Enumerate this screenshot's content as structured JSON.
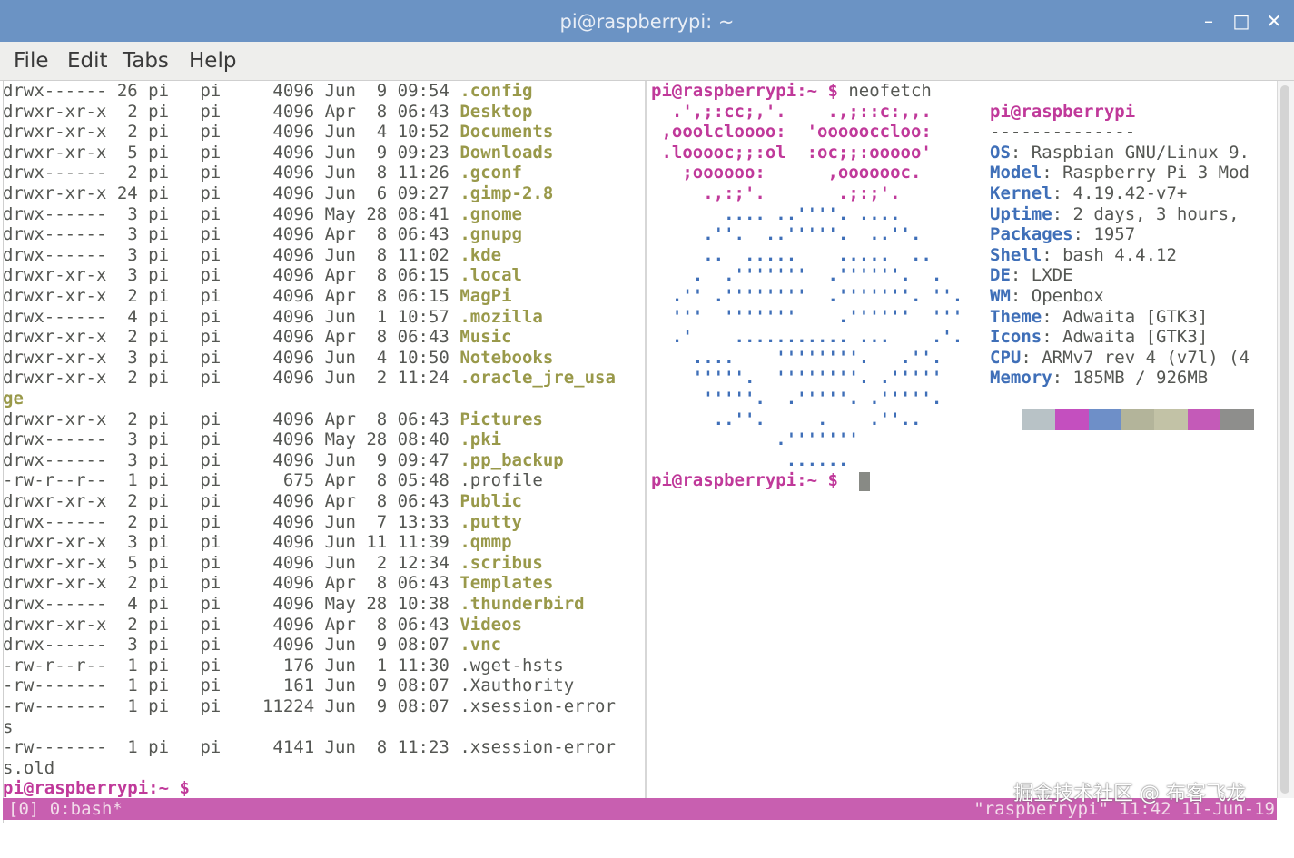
{
  "window": {
    "title": "pi@raspberrypi: ~",
    "minimize_label": "–",
    "maximize_label": "□",
    "close_label": "✕"
  },
  "menu": [
    "File",
    "Edit",
    "Tabs",
    "Help"
  ],
  "left_pane": {
    "listing": [
      {
        "perm": "drwx------",
        "links": "26",
        "owner": "pi",
        "group": "pi",
        "size": "4096",
        "month": "Jun",
        "day": "9",
        "time": "09:54",
        "name": ".config",
        "type": "dir"
      },
      {
        "perm": "drwxr-xr-x",
        "links": "2",
        "owner": "pi",
        "group": "pi",
        "size": "4096",
        "month": "Apr",
        "day": "8",
        "time": "06:43",
        "name": "Desktop",
        "type": "dir"
      },
      {
        "perm": "drwxr-xr-x",
        "links": "2",
        "owner": "pi",
        "group": "pi",
        "size": "4096",
        "month": "Jun",
        "day": "4",
        "time": "10:52",
        "name": "Documents",
        "type": "dir"
      },
      {
        "perm": "drwxr-xr-x",
        "links": "5",
        "owner": "pi",
        "group": "pi",
        "size": "4096",
        "month": "Jun",
        "day": "9",
        "time": "09:23",
        "name": "Downloads",
        "type": "dir"
      },
      {
        "perm": "drwx------",
        "links": "2",
        "owner": "pi",
        "group": "pi",
        "size": "4096",
        "month": "Jun",
        "day": "8",
        "time": "11:26",
        "name": ".gconf",
        "type": "dir"
      },
      {
        "perm": "drwxr-xr-x",
        "links": "24",
        "owner": "pi",
        "group": "pi",
        "size": "4096",
        "month": "Jun",
        "day": "6",
        "time": "09:27",
        "name": ".gimp-2.8",
        "type": "dir"
      },
      {
        "perm": "drwx------",
        "links": "3",
        "owner": "pi",
        "group": "pi",
        "size": "4096",
        "month": "May",
        "day": "28",
        "time": "08:41",
        "name": ".gnome",
        "type": "dir"
      },
      {
        "perm": "drwx------",
        "links": "3",
        "owner": "pi",
        "group": "pi",
        "size": "4096",
        "month": "Apr",
        "day": "8",
        "time": "06:43",
        "name": ".gnupg",
        "type": "dir"
      },
      {
        "perm": "drwx------",
        "links": "3",
        "owner": "pi",
        "group": "pi",
        "size": "4096",
        "month": "Jun",
        "day": "8",
        "time": "11:02",
        "name": ".kde",
        "type": "dir"
      },
      {
        "perm": "drwxr-xr-x",
        "links": "3",
        "owner": "pi",
        "group": "pi",
        "size": "4096",
        "month": "Apr",
        "day": "8",
        "time": "06:15",
        "name": ".local",
        "type": "dir"
      },
      {
        "perm": "drwxr-xr-x",
        "links": "2",
        "owner": "pi",
        "group": "pi",
        "size": "4096",
        "month": "Apr",
        "day": "8",
        "time": "06:15",
        "name": "MagPi",
        "type": "dir"
      },
      {
        "perm": "drwx------",
        "links": "4",
        "owner": "pi",
        "group": "pi",
        "size": "4096",
        "month": "Jun",
        "day": "1",
        "time": "10:57",
        "name": ".mozilla",
        "type": "dir"
      },
      {
        "perm": "drwxr-xr-x",
        "links": "2",
        "owner": "pi",
        "group": "pi",
        "size": "4096",
        "month": "Apr",
        "day": "8",
        "time": "06:43",
        "name": "Music",
        "type": "dir"
      },
      {
        "perm": "drwxr-xr-x",
        "links": "3",
        "owner": "pi",
        "group": "pi",
        "size": "4096",
        "month": "Jun",
        "day": "4",
        "time": "10:50",
        "name": "Notebooks",
        "type": "dir"
      },
      {
        "perm": "drwxr-xr-x",
        "links": "2",
        "owner": "pi",
        "group": "pi",
        "size": "4096",
        "month": "Jun",
        "day": "2",
        "time": "11:24",
        "name": ".oracle_jre_usa",
        "wrap": "ge",
        "type": "dir"
      },
      {
        "perm": "drwxr-xr-x",
        "links": "2",
        "owner": "pi",
        "group": "pi",
        "size": "4096",
        "month": "Apr",
        "day": "8",
        "time": "06:43",
        "name": "Pictures",
        "type": "dir"
      },
      {
        "perm": "drwx------",
        "links": "3",
        "owner": "pi",
        "group": "pi",
        "size": "4096",
        "month": "May",
        "day": "28",
        "time": "08:40",
        "name": ".pki",
        "type": "dir"
      },
      {
        "perm": "drwx------",
        "links": "3",
        "owner": "pi",
        "group": "pi",
        "size": "4096",
        "month": "Jun",
        "day": "9",
        "time": "09:47",
        "name": ".pp_backup",
        "type": "dir"
      },
      {
        "perm": "-rw-r--r--",
        "links": "1",
        "owner": "pi",
        "group": "pi",
        "size": "675",
        "month": "Apr",
        "day": "8",
        "time": "05:48",
        "name": ".profile",
        "type": "file"
      },
      {
        "perm": "drwxr-xr-x",
        "links": "2",
        "owner": "pi",
        "group": "pi",
        "size": "4096",
        "month": "Apr",
        "day": "8",
        "time": "06:43",
        "name": "Public",
        "type": "dir"
      },
      {
        "perm": "drwx------",
        "links": "2",
        "owner": "pi",
        "group": "pi",
        "size": "4096",
        "month": "Jun",
        "day": "7",
        "time": "13:33",
        "name": ".putty",
        "type": "dir"
      },
      {
        "perm": "drwxr-xr-x",
        "links": "3",
        "owner": "pi",
        "group": "pi",
        "size": "4096",
        "month": "Jun",
        "day": "11",
        "time": "11:39",
        "name": ".qmmp",
        "type": "dir"
      },
      {
        "perm": "drwxr-xr-x",
        "links": "5",
        "owner": "pi",
        "group": "pi",
        "size": "4096",
        "month": "Jun",
        "day": "2",
        "time": "12:34",
        "name": ".scribus",
        "type": "dir"
      },
      {
        "perm": "drwxr-xr-x",
        "links": "2",
        "owner": "pi",
        "group": "pi",
        "size": "4096",
        "month": "Apr",
        "day": "8",
        "time": "06:43",
        "name": "Templates",
        "type": "dir"
      },
      {
        "perm": "drwx------",
        "links": "4",
        "owner": "pi",
        "group": "pi",
        "size": "4096",
        "month": "May",
        "day": "28",
        "time": "10:38",
        "name": ".thunderbird",
        "type": "dir"
      },
      {
        "perm": "drwxr-xr-x",
        "links": "2",
        "owner": "pi",
        "group": "pi",
        "size": "4096",
        "month": "Apr",
        "day": "8",
        "time": "06:43",
        "name": "Videos",
        "type": "dir"
      },
      {
        "perm": "drwx------",
        "links": "3",
        "owner": "pi",
        "group": "pi",
        "size": "4096",
        "month": "Jun",
        "day": "9",
        "time": "08:07",
        "name": ".vnc",
        "type": "dir"
      },
      {
        "perm": "-rw-r--r--",
        "links": "1",
        "owner": "pi",
        "group": "pi",
        "size": "176",
        "month": "Jun",
        "day": "1",
        "time": "11:30",
        "name": ".wget-hsts",
        "type": "file"
      },
      {
        "perm": "-rw-------",
        "links": "1",
        "owner": "pi",
        "group": "pi",
        "size": "161",
        "month": "Jun",
        "day": "9",
        "time": "08:07",
        "name": ".Xauthority",
        "type": "file"
      },
      {
        "perm": "-rw-------",
        "links": "1",
        "owner": "pi",
        "group": "pi",
        "size": "11224",
        "month": "Jun",
        "day": "9",
        "time": "08:07",
        "name": ".xsession-error",
        "wrap": "s",
        "type": "file"
      },
      {
        "perm": "-rw-------",
        "links": "1",
        "owner": "pi",
        "group": "pi",
        "size": "4141",
        "month": "Jun",
        "day": "8",
        "time": "11:23",
        "name": ".xsession-error",
        "wrap": "s.old",
        "type": "file"
      }
    ],
    "prompt": "pi@raspberrypi:~ $"
  },
  "right_pane": {
    "prompt": "pi@raspberrypi:~ $",
    "command": " neofetch",
    "ascii_art": [
      {
        "text": "  .',;:cc;,'.    .,;::c:,,.",
        "style": "m"
      },
      {
        "text": " ,ooolcloooo:  'oooooccloo:",
        "style": "m"
      },
      {
        "text": " .looooc;;:ol  :oc;;:ooooo'",
        "style": "m"
      },
      {
        "text": "   ;oooooo:      ,ooooooc.",
        "style": "m"
      },
      {
        "text": "     .,:;'.       .;:;'.",
        "style": "m"
      },
      {
        "text": "       .... ..''''. ....",
        "style": "b"
      },
      {
        "text": "     .''.  ..'''''.  ..''.",
        "style": "b"
      },
      {
        "text": "     ..  .....    .....  ..",
        "style": "b"
      },
      {
        "text": "    .  .'''''''  .''''''.  .",
        "style": "b"
      },
      {
        "text": "  .'' .''''''''  .'''''''. ''.",
        "style": "b"
      },
      {
        "text": "  '''  '''''''    .''''''  '''",
        "style": "b"
      },
      {
        "text": "  .'    ........... ...    .'.",
        "style": "b"
      },
      {
        "text": "    ....    ''''''''.   .''.",
        "style": "b"
      },
      {
        "text": "    '''''.  ''''''''. .'''''",
        "style": "b"
      },
      {
        "text": "     '''''.  .'''''. .'''''.",
        "style": "b"
      },
      {
        "text": "      ..''.     .    .''..",
        "style": "b"
      },
      {
        "text": "            .'''''''",
        "style": "b"
      },
      {
        "text": "             ......",
        "style": "b"
      }
    ],
    "userhost": "pi@raspberrypi",
    "separator": "--------------",
    "info": [
      {
        "key": "OS",
        "value": " Raspbian GNU/Linux 9."
      },
      {
        "key": "Model",
        "value": " Raspberry Pi 3 Mod"
      },
      {
        "key": "Kernel",
        "value": " 4.19.42-v7+"
      },
      {
        "key": "Uptime",
        "value": " 2 days, 3 hours,"
      },
      {
        "key": "Packages",
        "value": " 1957"
      },
      {
        "key": "Shell",
        "value": " bash 4.4.12"
      },
      {
        "key": "DE",
        "value": " LXDE"
      },
      {
        "key": "WM",
        "value": " Openbox"
      },
      {
        "key": "Theme",
        "value": " Adwaita [GTK3]"
      },
      {
        "key": "Icons",
        "value": " Adwaita [GTK3]"
      },
      {
        "key": "CPU",
        "value": " ARMv7 rev 4 (v7l) (4"
      },
      {
        "key": "Memory",
        "value": " 185MB / 926MB"
      }
    ],
    "palette": [
      "#b8c2c6",
      "#c44fbf",
      "#6e8fc8",
      "#b3b49a",
      "#c2c2a6",
      "#c45ab8",
      "#8e8e8c"
    ],
    "prompt2": "pi@raspberrypi:~ $"
  },
  "status": {
    "left": "[0] 0:bash*",
    "right": "\"raspberrypi\" 11:42 11-Jun-19"
  },
  "watermark": "掘金技术社区 @ 布客飞龙"
}
